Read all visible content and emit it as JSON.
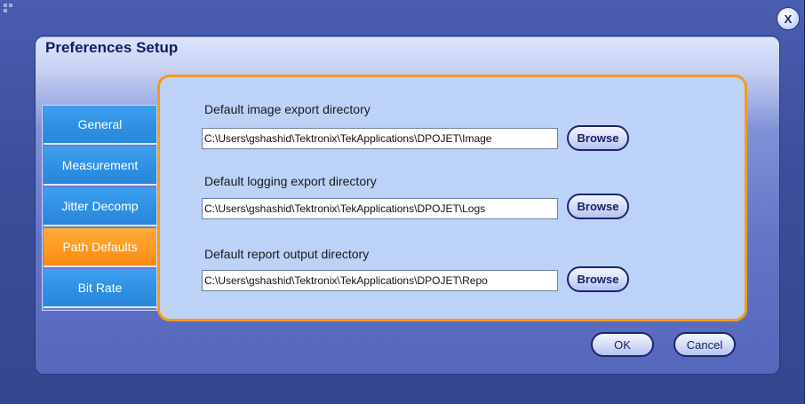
{
  "window": {
    "close_label": "X"
  },
  "dialog": {
    "title": "Preferences Setup"
  },
  "tabs": [
    {
      "label": "General",
      "active": false
    },
    {
      "label": "Measurement",
      "active": false
    },
    {
      "label": "Jitter Decomp",
      "active": false
    },
    {
      "label": "Path Defaults",
      "active": true
    },
    {
      "label": "Bit Rate",
      "active": false
    }
  ],
  "fields": [
    {
      "label": "Default image export directory",
      "value": "C:\\Users\\gshashid\\Tektronix\\TekApplications\\DPOJET\\Image",
      "button": "Browse"
    },
    {
      "label": "Default logging export directory",
      "value": "C:\\Users\\gshashid\\Tektronix\\TekApplications\\DPOJET\\Logs",
      "button": "Browse"
    },
    {
      "label": "Default report output directory",
      "value": "C:\\Users\\gshashid\\Tektronix\\TekApplications\\DPOJET\\Repo",
      "button": "Browse"
    }
  ],
  "footer": {
    "ok_label": "OK",
    "cancel_label": "Cancel"
  },
  "colors": {
    "accent": "#f59a1c",
    "tab_blue": "#2e8fe3",
    "tab_active": "#ff9820",
    "panel_bg": "#bcd2f7"
  }
}
